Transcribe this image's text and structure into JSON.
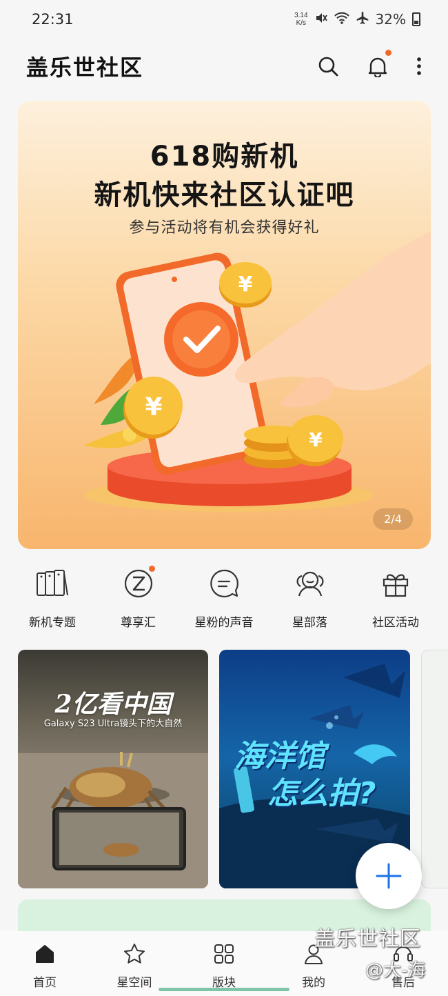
{
  "status_bar": {
    "time": "22:31",
    "net_speed_value": "3.14",
    "net_speed_unit": "K/s",
    "battery": "32%"
  },
  "app_bar": {
    "title": "盖乐世社区"
  },
  "banner": {
    "title_line1": "618购新机",
    "title_line2": "新机快来社区认证吧",
    "subtitle": "参与活动将有机会获得好礼",
    "page_indicator": "2/4",
    "coin_glyph": "¥"
  },
  "quick_nav": [
    {
      "label": "新机专题",
      "icon": "new-phones-icon"
    },
    {
      "label": "尊享汇",
      "icon": "z-logo-icon"
    },
    {
      "label": "星粉的声音",
      "icon": "chat-bubble-icon"
    },
    {
      "label": "星部落",
      "icon": "group-icon"
    },
    {
      "label": "社区活动",
      "icon": "gift-icon"
    }
  ],
  "cards": [
    {
      "title": "2亿看中国",
      "subtitle": "Galaxy S23 Ultra镜头下的大自然"
    },
    {
      "title_line1": "海洋馆",
      "title_line2": "怎么拍?"
    }
  ],
  "bottom_nav": [
    {
      "label": "首页",
      "icon": "home-icon",
      "active": true
    },
    {
      "label": "星空间",
      "icon": "star-icon",
      "active": false
    },
    {
      "label": "版块",
      "icon": "grid-icon",
      "active": false
    },
    {
      "label": "我的",
      "icon": "person-icon",
      "active": false
    },
    {
      "label": "售后",
      "icon": "service-icon",
      "active": false
    }
  ],
  "watermark": {
    "title": "盖乐世社区",
    "user": "@大-海"
  },
  "colors": {
    "accent_dot": "#f06a2b",
    "fab_plus": "#1a73e8",
    "banner_orange": "#f26a2a"
  }
}
